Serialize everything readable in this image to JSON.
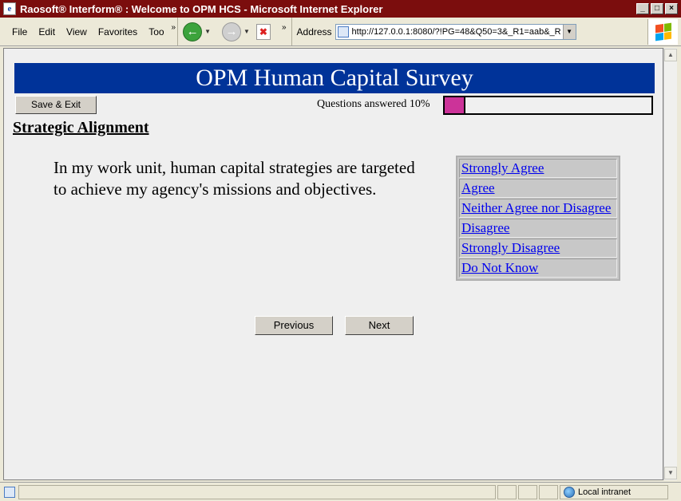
{
  "window": {
    "title": "Raosoft® Interform® : Welcome to OPM HCS - Microsoft Internet Explorer",
    "minimize": "_",
    "maximize": "□",
    "close": "×"
  },
  "menu": {
    "file": "File",
    "edit": "Edit",
    "view": "View",
    "favorites": "Favorites",
    "tools": "Too",
    "more": "»"
  },
  "toolbar": {
    "more": "»",
    "address_label": "Address",
    "url": "http://127.0.0.1:8080/?!PG=48&Q50=3&_R1=aab&_R"
  },
  "page": {
    "banner": "OPM Human Capital Survey",
    "save_exit": "Save & Exit",
    "progress_label": "Questions answered 10%",
    "progress_value": 0.1,
    "section_title": "Strategic Alignment",
    "question": "In my work unit, human capital strategies are targeted to achieve my agency's missions and objectives.",
    "answers": [
      "Strongly Agree",
      "Agree",
      "Neither Agree nor Disagree",
      "Disagree",
      "Strongly Disagree",
      "Do Not Know"
    ],
    "previous": "Previous",
    "next": "Next"
  },
  "statusbar": {
    "zone": "Local intranet"
  },
  "colors": {
    "banner": "#003399",
    "progress_fill": "#cc3399",
    "link": "#0000ee",
    "titlebar": "#7b0d0d"
  }
}
